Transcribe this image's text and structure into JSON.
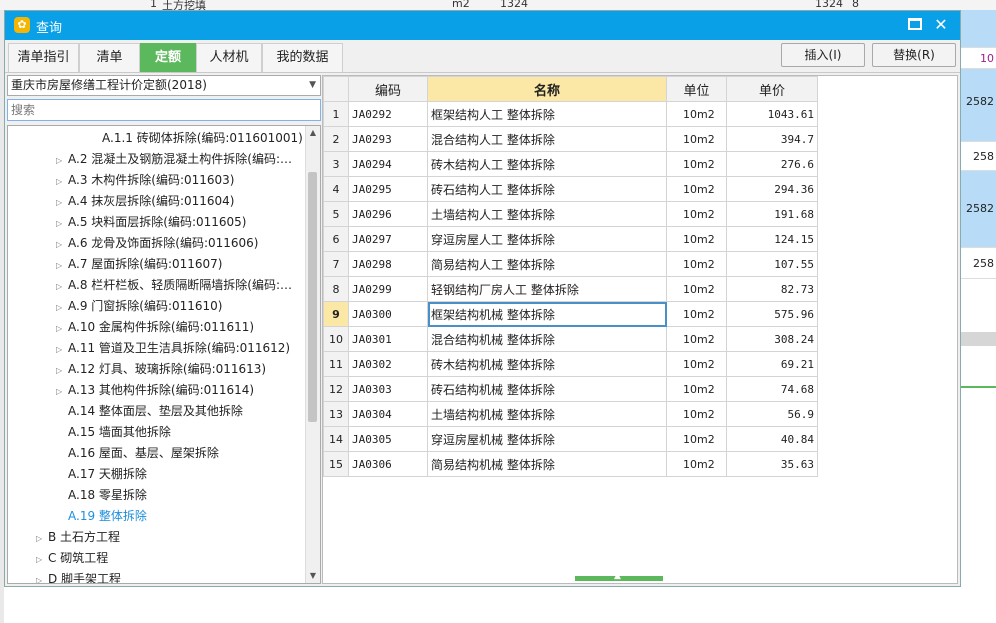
{
  "background": {
    "top_texts": [
      "1",
      "土方挖填",
      "m2",
      "1324",
      "1324",
      "8"
    ],
    "right_cells": [
      {
        "text": "",
        "style": "blue"
      },
      {
        "text": "10",
        "style": "white"
      },
      {
        "text": "2582",
        "style": "blue"
      },
      {
        "text": "258",
        "style": "white"
      },
      {
        "text": "2582",
        "style": "blue"
      },
      {
        "text": "258",
        "style": "white"
      }
    ]
  },
  "dialog": {
    "title": "查询",
    "tabs": [
      {
        "label": "清单指引",
        "active": false
      },
      {
        "label": "清单",
        "active": false
      },
      {
        "label": "定额",
        "active": true
      },
      {
        "label": "人材机",
        "active": false
      },
      {
        "label": "我的数据",
        "active": false
      }
    ],
    "insert_label": "插入(I)",
    "replace_label": "替换(R)"
  },
  "left": {
    "library": "重庆市房屋修缮工程计价定额(2018)",
    "search_placeholder": "搜索",
    "tree": [
      {
        "text": "A.1.1 砖砌体拆除(编码:011601001)",
        "level": 3,
        "arrow": false,
        "selected": false
      },
      {
        "text": "A.2 混凝土及钢筋混凝土构件拆除(编码:…",
        "level": 2,
        "arrow": true,
        "selected": false
      },
      {
        "text": "A.3 木构件拆除(编码:011603)",
        "level": 2,
        "arrow": true,
        "selected": false
      },
      {
        "text": "A.4 抹灰层拆除(编码:011604)",
        "level": 2,
        "arrow": true,
        "selected": false
      },
      {
        "text": "A.5 块料面层拆除(编码:011605)",
        "level": 2,
        "arrow": true,
        "selected": false
      },
      {
        "text": "A.6 龙骨及饰面拆除(编码:011606)",
        "level": 2,
        "arrow": true,
        "selected": false
      },
      {
        "text": "A.7 屋面拆除(编码:011607)",
        "level": 2,
        "arrow": true,
        "selected": false
      },
      {
        "text": "A.8 栏杆栏板、轻质隔断隔墙拆除(编码:…",
        "level": 2,
        "arrow": true,
        "selected": false
      },
      {
        "text": "A.9 门窗拆除(编码:011610)",
        "level": 2,
        "arrow": true,
        "selected": false
      },
      {
        "text": "A.10 金属构件拆除(编码:011611)",
        "level": 2,
        "arrow": true,
        "selected": false
      },
      {
        "text": "A.11 管道及卫生洁具拆除(编码:011612)",
        "level": 2,
        "arrow": true,
        "selected": false
      },
      {
        "text": "A.12 灯具、玻璃拆除(编码:011613)",
        "level": 2,
        "arrow": true,
        "selected": false
      },
      {
        "text": "A.13 其他构件拆除(编码:011614)",
        "level": 2,
        "arrow": true,
        "selected": false
      },
      {
        "text": "A.14 整体面层、垫层及其他拆除",
        "level": 2,
        "arrow": false,
        "selected": false
      },
      {
        "text": "A.15 墙面其他拆除",
        "level": 2,
        "arrow": false,
        "selected": false
      },
      {
        "text": "A.16 屋面、基层、屋架拆除",
        "level": 2,
        "arrow": false,
        "selected": false
      },
      {
        "text": "A.17 天棚拆除",
        "level": 2,
        "arrow": false,
        "selected": false
      },
      {
        "text": "A.18 零星拆除",
        "level": 2,
        "arrow": false,
        "selected": false
      },
      {
        "text": "A.19 整体拆除",
        "level": 2,
        "arrow": false,
        "selected": true
      },
      {
        "text": "B 土石方工程",
        "level": 1,
        "arrow": true,
        "selected": false
      },
      {
        "text": "C 砌筑工程",
        "level": 1,
        "arrow": true,
        "selected": false
      },
      {
        "text": "D 脚手架工程",
        "level": 1,
        "arrow": true,
        "selected": false
      }
    ]
  },
  "table": {
    "headers": {
      "code": "编码",
      "name": "名称",
      "unit": "单位",
      "price": "单价"
    },
    "active_row": 9,
    "rows": [
      {
        "n": "1",
        "code": "JA0292",
        "name": "框架结构人工 整体拆除",
        "unit": "10m2",
        "price": "1043.61"
      },
      {
        "n": "2",
        "code": "JA0293",
        "name": "混合结构人工 整体拆除",
        "unit": "10m2",
        "price": "394.7"
      },
      {
        "n": "3",
        "code": "JA0294",
        "name": "砖木结构人工 整体拆除",
        "unit": "10m2",
        "price": "276.6"
      },
      {
        "n": "4",
        "code": "JA0295",
        "name": "砖石结构人工 整体拆除",
        "unit": "10m2",
        "price": "294.36"
      },
      {
        "n": "5",
        "code": "JA0296",
        "name": "土墙结构人工 整体拆除",
        "unit": "10m2",
        "price": "191.68"
      },
      {
        "n": "6",
        "code": "JA0297",
        "name": "穿逗房屋人工 整体拆除",
        "unit": "10m2",
        "price": "124.15"
      },
      {
        "n": "7",
        "code": "JA0298",
        "name": "简易结构人工 整体拆除",
        "unit": "10m2",
        "price": "107.55"
      },
      {
        "n": "8",
        "code": "JA0299",
        "name": "轻钢结构厂房人工 整体拆除",
        "unit": "10m2",
        "price": "82.73"
      },
      {
        "n": "9",
        "code": "JA0300",
        "name": "框架结构机械 整体拆除",
        "unit": "10m2",
        "price": "575.96"
      },
      {
        "n": "10",
        "code": "JA0301",
        "name": "混合结构机械 整体拆除",
        "unit": "10m2",
        "price": "308.24"
      },
      {
        "n": "11",
        "code": "JA0302",
        "name": "砖木结构机械 整体拆除",
        "unit": "10m2",
        "price": "69.21"
      },
      {
        "n": "12",
        "code": "JA0303",
        "name": "砖石结构机械 整体拆除",
        "unit": "10m2",
        "price": "74.68"
      },
      {
        "n": "13",
        "code": "JA0304",
        "name": "土墙结构机械 整体拆除",
        "unit": "10m2",
        "price": "56.9"
      },
      {
        "n": "14",
        "code": "JA0305",
        "name": "穿逗房屋机械 整体拆除",
        "unit": "10m2",
        "price": "40.84"
      },
      {
        "n": "15",
        "code": "JA0306",
        "name": "简易结构机械 整体拆除",
        "unit": "10m2",
        "price": "35.63"
      }
    ]
  },
  "colors": {
    "title_bar": "#0aa0e8",
    "active_tab": "#5cb85c",
    "selected_tree": "#1e8fdc",
    "header_highlight": "#fbe8a6"
  }
}
